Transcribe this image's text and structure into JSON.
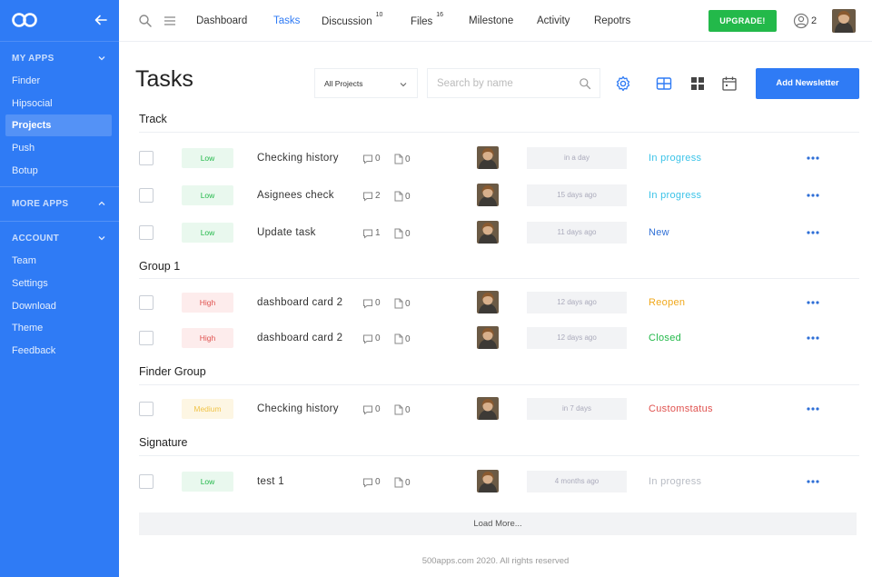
{
  "sidebar": {
    "sections": [
      {
        "label": "MY APPS",
        "chevron": "chevron-down"
      },
      {
        "label": "MORE APPS",
        "chevron": "chevron-up"
      },
      {
        "label": "ACCOUNT",
        "chevron": "chevron-down"
      }
    ],
    "my_apps": [
      "Finder",
      "Hipsocial",
      "Projects",
      "Push",
      "Botup"
    ],
    "account": [
      "Team",
      "Settings",
      "Download",
      "Theme",
      "Feedback"
    ],
    "active_item": "Projects",
    "bg_color": "#2f7bf5"
  },
  "nav": {
    "tabs": [
      {
        "label": "Dashboard",
        "badge": ""
      },
      {
        "label": "Tasks",
        "badge": ""
      },
      {
        "label": "Discussion",
        "badge": "10"
      },
      {
        "label": "Files",
        "badge": "16"
      },
      {
        "label": "Milestone",
        "badge": ""
      },
      {
        "label": "Activity",
        "badge": ""
      },
      {
        "label": "Repotrs",
        "badge": ""
      }
    ],
    "active_tab": "Tasks",
    "upgrade_label": "UPGRADE!",
    "user_count": "2"
  },
  "header": {
    "title": "Tasks",
    "project_select": "All Projects",
    "search_placeholder": "Search by name",
    "add_button": "Add Newsletter"
  },
  "groups": [
    {
      "title": "Track",
      "tasks": [
        {
          "priority": "Low",
          "name": "Checking history",
          "comments": "0",
          "files": "0",
          "date": "in a day",
          "status": "In progress",
          "status_color": "#3bc3e8"
        },
        {
          "priority": "Low",
          "name": "Asignees check",
          "comments": "2",
          "files": "0",
          "date": "15 days ago",
          "status": "In progress",
          "status_color": "#3bc3e8"
        },
        {
          "priority": "Low",
          "name": "Update task",
          "comments": "1",
          "files": "0",
          "date": "11 days ago",
          "status": "New",
          "status_color": "#2f6fd6"
        }
      ]
    },
    {
      "title": "Group 1",
      "tasks": [
        {
          "priority": "High",
          "name": "dashboard card 2",
          "comments": "0",
          "files": "0",
          "date": "12 days ago",
          "status": "Reopen",
          "status_color": "#f0a81c"
        },
        {
          "priority": "High",
          "name": "dashboard card 2",
          "comments": "0",
          "files": "0",
          "date": "12 days ago",
          "status": "Closed",
          "status_color": "#23b94a"
        }
      ]
    },
    {
      "title": "Finder Group",
      "tasks": [
        {
          "priority": "Medium",
          "name": "Checking history",
          "comments": "0",
          "files": "0",
          "date": "in 7 days",
          "status": "Customstatus",
          "status_color": "#e0524f"
        }
      ]
    },
    {
      "title": "Signature",
      "tasks": [
        {
          "priority": "Low",
          "name": "test 1",
          "comments": "0",
          "files": "0",
          "date": "4 months ago",
          "status": "In progress",
          "status_color": "#b8bcc4"
        }
      ]
    }
  ],
  "load_more": "Load More...",
  "footer": "500apps.com 2020. All rights reserved",
  "colors": {
    "accent": "#2f7bf5",
    "upgrade": "#23b94a"
  }
}
